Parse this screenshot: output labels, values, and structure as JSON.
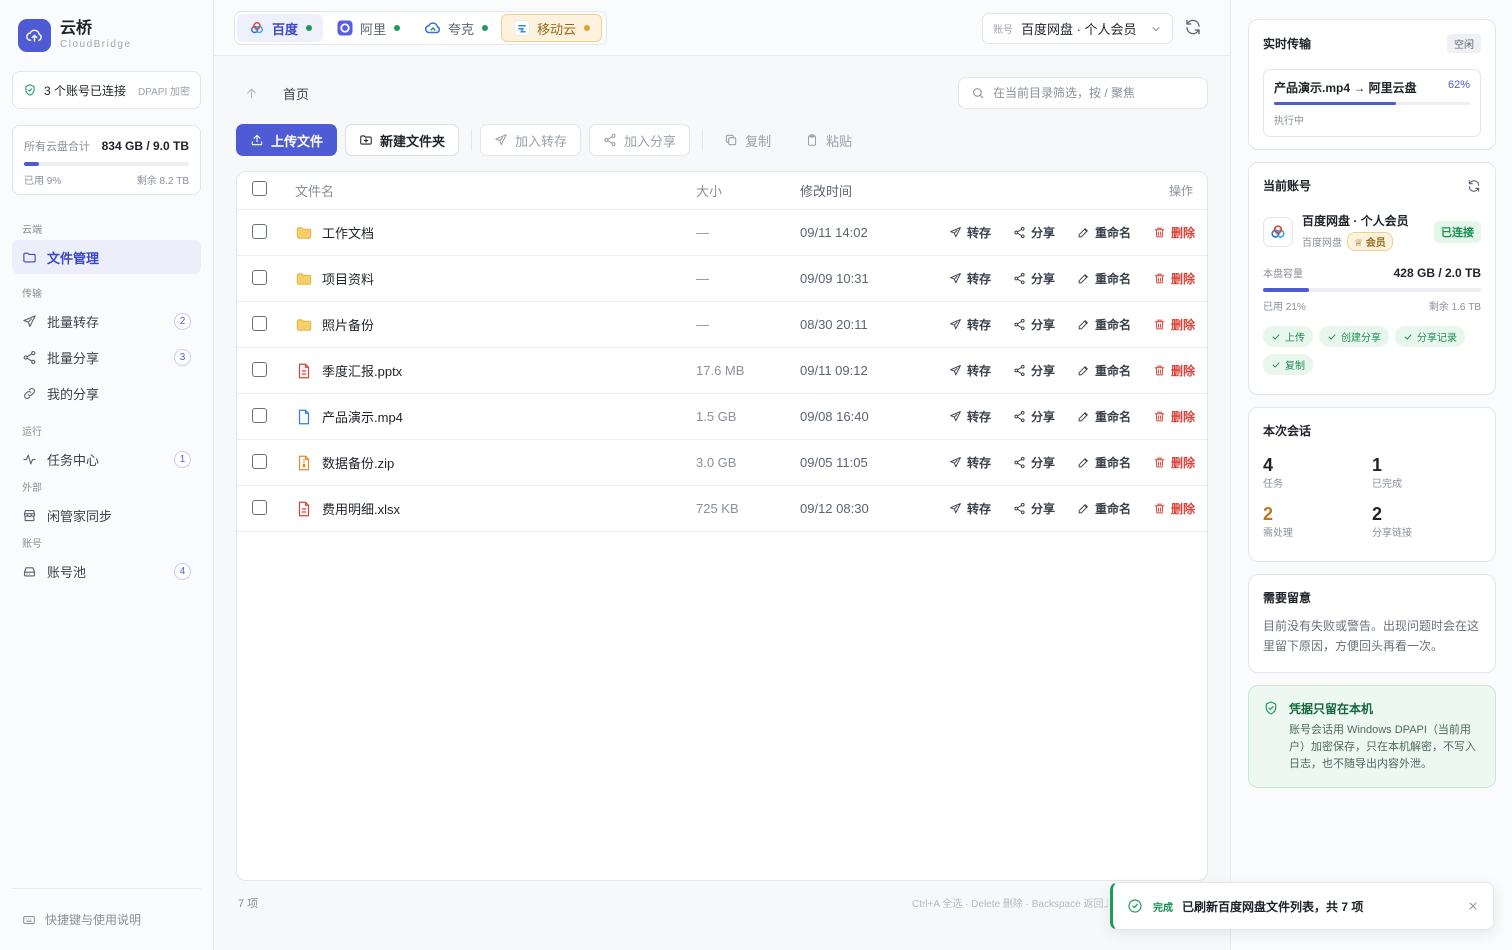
{
  "brand": {
    "name": "云桥",
    "subtitle": "CloudBridge"
  },
  "connection": {
    "text": "3 个账号已连接",
    "tag": "DPAPI 加密"
  },
  "storage": {
    "label": "所有云盘合计",
    "value": "834 GB / 9.0 TB",
    "used_text": "已用 9%",
    "remaining_text": "剩余 8.2 TB",
    "used_fraction": 0.09
  },
  "nav": {
    "sections": [
      {
        "title": "云端",
        "items": [
          {
            "label": "文件管理",
            "icon": "folder-icon",
            "active": true
          }
        ]
      },
      {
        "title": "传输",
        "items": [
          {
            "label": "批量转存",
            "icon": "send-icon",
            "badge": "2"
          },
          {
            "label": "批量分享",
            "icon": "share-icon",
            "badge": "3"
          },
          {
            "label": "我的分享",
            "icon": "link-icon"
          }
        ]
      },
      {
        "title": "运行",
        "items": [
          {
            "label": "任务中心",
            "icon": "activity-icon",
            "badge": "1"
          }
        ]
      },
      {
        "title": "外部",
        "items": [
          {
            "label": "闲管家同步",
            "icon": "store-icon"
          }
        ]
      },
      {
        "title": "账号",
        "items": [
          {
            "label": "账号池",
            "icon": "drive-icon",
            "badge": "4"
          }
        ]
      }
    ],
    "footer": "快捷键与使用说明"
  },
  "tabs": [
    {
      "label": "百度",
      "active": true,
      "dot_color": "#1a9d5a",
      "icon": "baidu-icon"
    },
    {
      "label": "阿里",
      "dot_color": "#1a9d5a",
      "icon": "aliyun-icon"
    },
    {
      "label": "夸克",
      "dot_color": "#1a9d5a",
      "icon": "quark-icon"
    },
    {
      "label": "移动云",
      "warn": true,
      "dot_color": "#e0a12e",
      "icon": "mobile-cloud-icon"
    }
  ],
  "account_select": {
    "label": "账号",
    "value": "百度网盘 · 个人会员"
  },
  "breadcrumb": {
    "home": "首页"
  },
  "filter": {
    "placeholder": "在当前目录筛选，按 / 聚焦"
  },
  "toolbar": {
    "upload": "上传文件",
    "new_folder": "新建文件夹",
    "add_transfer": "加入转存",
    "add_share": "加入分享",
    "copy": "复制",
    "paste": "粘贴"
  },
  "table": {
    "headers": {
      "name": "文件名",
      "size": "大小",
      "time": "修改时间",
      "actions": "操作"
    },
    "action_labels": {
      "transfer": "转存",
      "share": "分享",
      "rename": "重命名",
      "delete": "删除"
    },
    "rows": [
      {
        "name": "工作文档",
        "type": "folder",
        "size": "—",
        "time": "09/11 14:02"
      },
      {
        "name": "项目资料",
        "type": "folder",
        "size": "—",
        "time": "09/09 10:31"
      },
      {
        "name": "照片备份",
        "type": "folder",
        "size": "—",
        "time": "08/30 20:11"
      },
      {
        "name": "季度汇报.pptx",
        "type": "doc-red",
        "size": "17.6 MB",
        "time": "09/11 09:12"
      },
      {
        "name": "产品演示.mp4",
        "type": "doc-blue",
        "size": "1.5 GB",
        "time": "09/08 16:40"
      },
      {
        "name": "数据备份.zip",
        "type": "zip",
        "size": "3.0 GB",
        "time": "09/05 11:05"
      },
      {
        "name": "费用明细.xlsx",
        "type": "doc-red",
        "size": "725 KB",
        "time": "09/12 08:30"
      }
    ]
  },
  "footer": {
    "count": "7 项",
    "hint": "Ctrl+A 全选 · Delete 删除 · Backspace 返回上级"
  },
  "realtime": {
    "title": "实时传输",
    "state": "空闲",
    "item": "产品演示.mp4 → 阿里云盘",
    "percent": "62%",
    "progress_fraction": 0.62,
    "status": "执行中"
  },
  "current_account": {
    "title": "当前账号",
    "name": "百度网盘 · 个人会员",
    "provider": "百度网盘",
    "vip": "会员",
    "status": "已连接",
    "capacity_label": "本盘容量",
    "capacity": "428 GB / 2.0 TB",
    "used_text": "已用 21%",
    "remaining_text": "剩余 1.6 TB",
    "used_fraction": 0.21,
    "capabilities": [
      "上传",
      "创建分享",
      "分享记录",
      "复制"
    ]
  },
  "session": {
    "title": "本次会话",
    "stats": [
      {
        "num": "4",
        "label": "任务"
      },
      {
        "num": "1",
        "label": "已完成"
      },
      {
        "num": "2",
        "label": "需处理",
        "warn": true
      },
      {
        "num": "2",
        "label": "分享链接"
      }
    ]
  },
  "attention": {
    "title": "需要留意",
    "text": "目前没有失败或警告。出现问题时会在这里留下原因，方便回头再看一次。"
  },
  "credential": {
    "title": "凭据只留在本机",
    "text": "账号会话用 Windows DPAPI（当前用户）加密保存，只在本机解密，不写入日志，也不随导出内容外泄。"
  },
  "toast": {
    "label": "完成",
    "message": "已刷新百度网盘文件列表，共 7 项"
  },
  "colors": {
    "accent": "#4f5bd5",
    "success": "#1a9d5a",
    "danger": "#d9423a",
    "warning": "#e0a12e"
  }
}
